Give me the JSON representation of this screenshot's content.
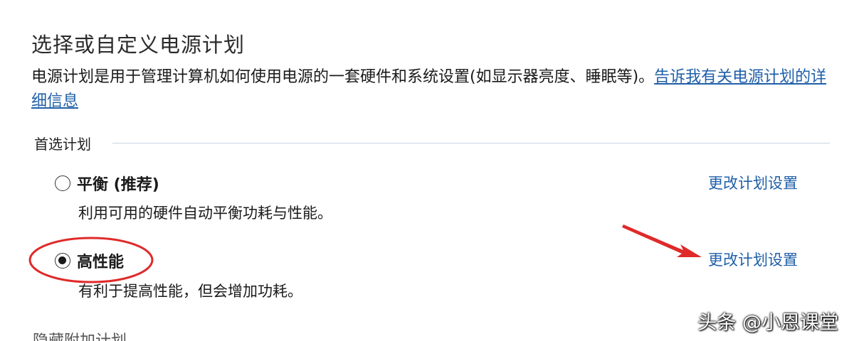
{
  "panel": {
    "title": "选择或自定义电源计划",
    "description": "电源计划是用于管理计算机如何使用电源的一套硬件和系统设置(如显示器亮度、睡眠等)。",
    "description_link": "告诉我有关电源计划的详细信息"
  },
  "preferred_plans": {
    "header": "首选计划",
    "plans": [
      {
        "name": "平衡 (推荐)",
        "description": "利用可用的硬件自动平衡功耗与性能。",
        "change_link": "更改计划设置",
        "selected": false
      },
      {
        "name": "高性能",
        "description": "有利于提高性能，但会增加功耗。",
        "change_link": "更改计划设置",
        "selected": true
      }
    ]
  },
  "next_section_partial": "隐藏附加计划",
  "watermark": "头条 @小恩课堂",
  "colors": {
    "link": "#1f5fa8",
    "annotation_red": "#e02a2a",
    "divider": "#c8d4e2"
  }
}
